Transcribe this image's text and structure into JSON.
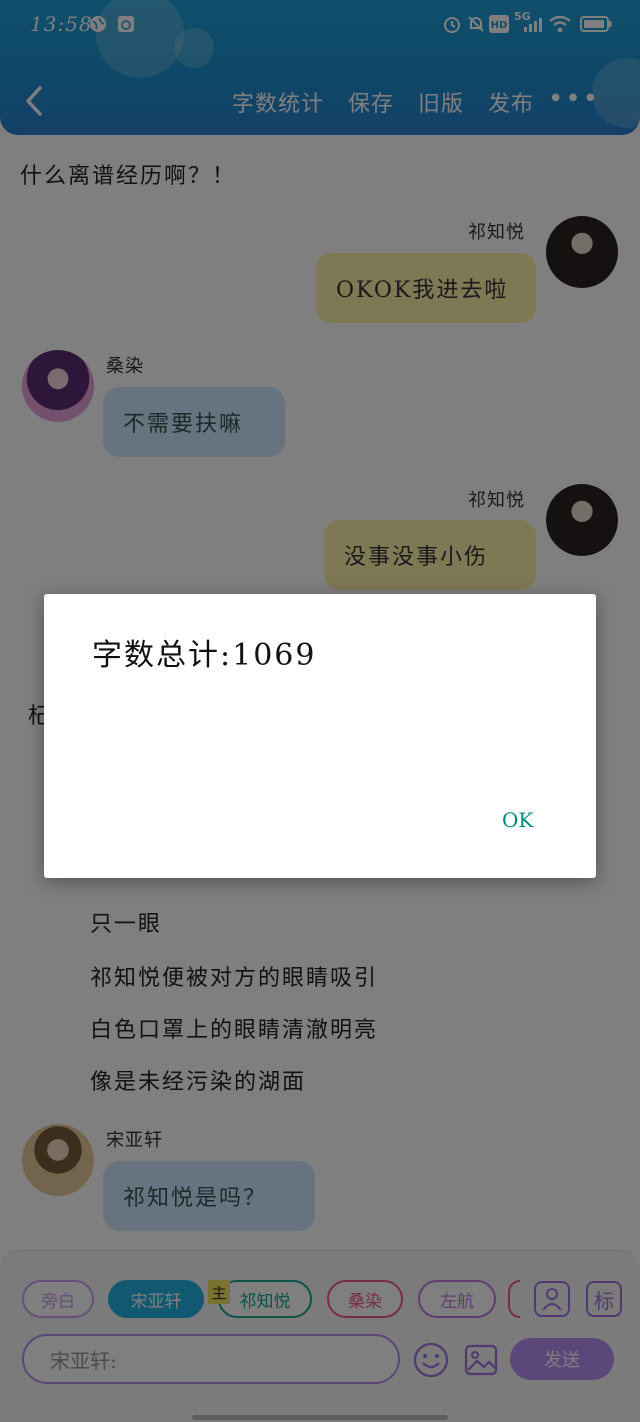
{
  "status_bar": {
    "time": "13:58",
    "network": "5G"
  },
  "nav": {
    "items": [
      "字数统计",
      "保存",
      "旧版",
      "发布"
    ]
  },
  "chat": {
    "top_line": "什么离谱经历啊？！",
    "messages": [
      {
        "sender": "祁知悦",
        "text": "OKOK我进去啦"
      },
      {
        "sender": "桑染",
        "text": "不需要扶嘛"
      },
      {
        "sender": "祁知悦",
        "text": "没事没事小伤"
      }
    ],
    "narration_partial_line": "杞",
    "narration": [
      "只一眼",
      "祁知悦便被对方的眼睛吸引",
      "白色口罩上的眼睛清澈明亮",
      "像是未经污染的湖面"
    ],
    "last_message": {
      "sender": "宋亚轩",
      "text": "祁知悦是吗？"
    }
  },
  "bottom": {
    "chips": [
      {
        "label": "旁白",
        "color": "#c8a0f2"
      },
      {
        "label": "宋亚轩",
        "color": "#23b2e3"
      },
      {
        "label": "祁知悦",
        "color": "#18a48f"
      },
      {
        "label": "桑染",
        "color": "#ee5a8e"
      },
      {
        "label": "左航",
        "color": "#c07be0"
      }
    ],
    "main_badge": "主",
    "tag_label": "标",
    "input_placeholder": "宋亚轩:",
    "send_label": "发送"
  },
  "dialog": {
    "text": "字数总计:1069",
    "ok_label": "OK"
  }
}
